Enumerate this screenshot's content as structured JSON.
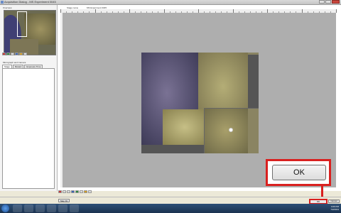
{
  "window": {
    "title": "Acquisition Dialog - MS Experiment 0045"
  },
  "left_panel": {
    "overview_label": "Overview",
    "settings_label": "Micrograph and Camera",
    "tabs": [
      {
        "label": "Stage"
      },
      {
        "label": "Mosaic"
      },
      {
        "label": "Exposure Time"
      }
    ]
  },
  "right_panel": {
    "stage_label": "Stage name",
    "stage_value": "MS Experiment 0045"
  },
  "buttons": {
    "ok_large": "OK",
    "ok_small": "OK",
    "cancel": "Cancel",
    "step": "Step Fit"
  },
  "taskbar": {
    "time": "4:06 PM",
    "date": "7/2/2013"
  },
  "colors": {
    "highlight": "#d9201f",
    "stage_bg": "#aeaeae"
  }
}
